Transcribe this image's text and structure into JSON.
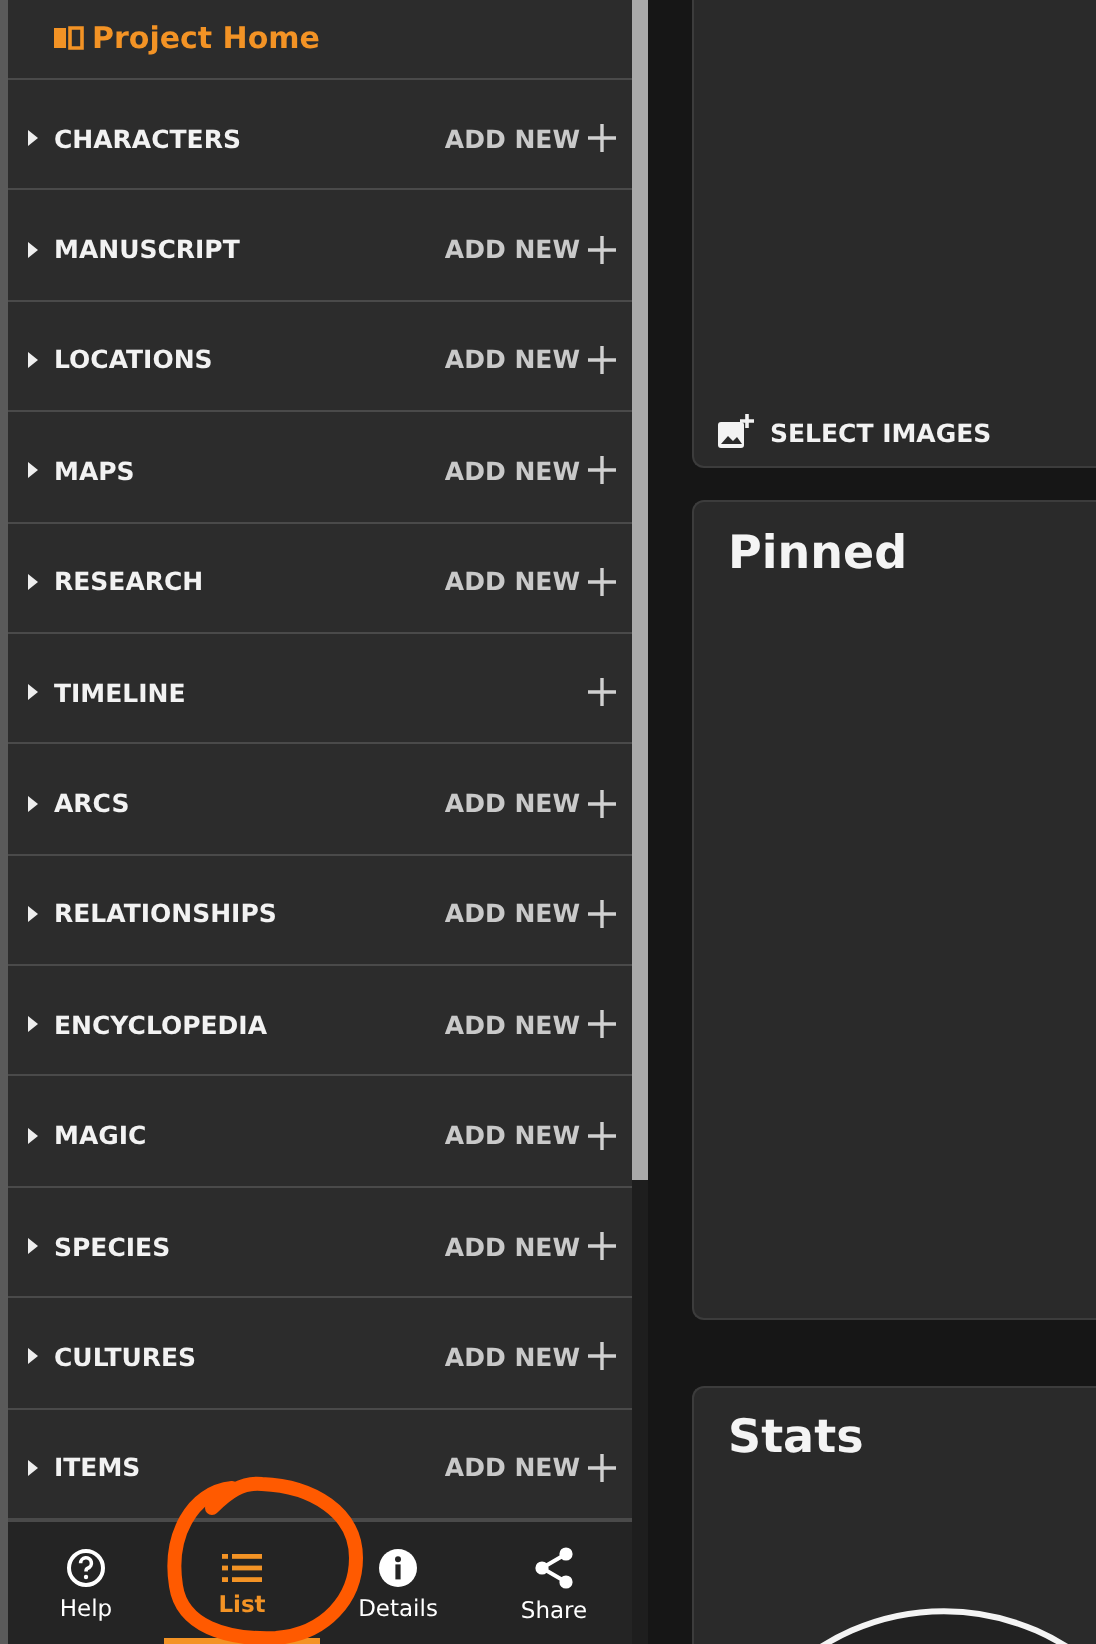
{
  "sidebar": {
    "header": "Project Home",
    "sections": [
      {
        "label": "CHARACTERS",
        "add_label": "ADD NEW"
      },
      {
        "label": "MANUSCRIPT",
        "add_label": "ADD NEW"
      },
      {
        "label": "LOCATIONS",
        "add_label": "ADD NEW"
      },
      {
        "label": "MAPS",
        "add_label": "ADD NEW"
      },
      {
        "label": "RESEARCH",
        "add_label": "ADD NEW"
      },
      {
        "label": "TIMELINE"
      },
      {
        "label": "ARCS",
        "add_label": "ADD NEW"
      },
      {
        "label": "RELATIONSHIPS",
        "add_label": "ADD NEW"
      },
      {
        "label": "ENCYCLOPEDIA",
        "add_label": "ADD NEW"
      },
      {
        "label": "MAGIC",
        "add_label": "ADD NEW"
      },
      {
        "label": "SPECIES",
        "add_label": "ADD NEW"
      },
      {
        "label": "CULTURES",
        "add_label": "ADD NEW"
      },
      {
        "label": "ITEMS",
        "add_label": "ADD NEW"
      }
    ]
  },
  "bottom_nav": [
    {
      "kind": "help",
      "label": "Help",
      "selected": false
    },
    {
      "kind": "list",
      "label": "List",
      "selected": true
    },
    {
      "kind": "details",
      "label": "Details",
      "selected": false
    },
    {
      "kind": "share",
      "label": "Share",
      "selected": false
    }
  ],
  "images_card": {
    "button": "SELECT IMAGES"
  },
  "pinned_card": {
    "title": "Pinned"
  },
  "stats_card": {
    "title": "Stats"
  }
}
